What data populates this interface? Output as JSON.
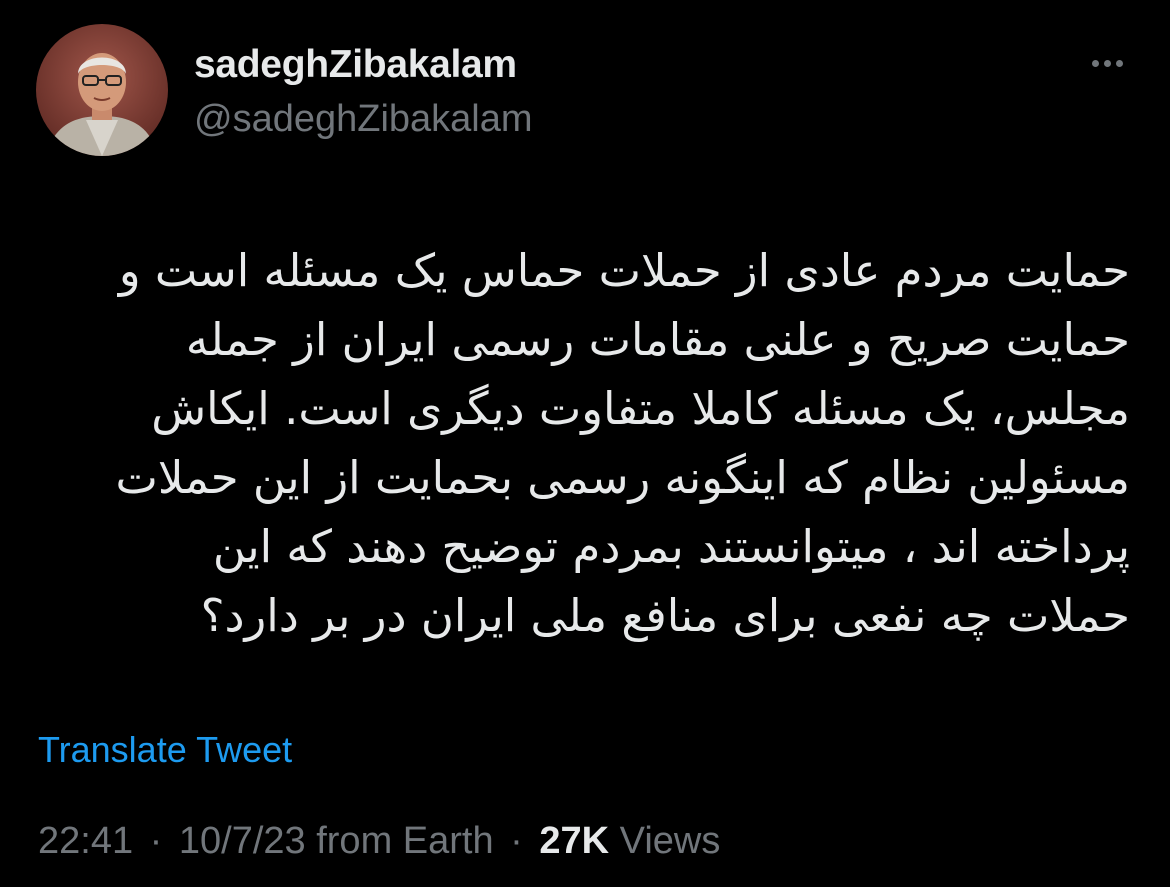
{
  "theme": {
    "background": "#000000",
    "text_primary": "#e7e9ea",
    "text_secondary": "#71767b",
    "link": "#1d9bf0"
  },
  "author": {
    "display_name": "sadeghZibakalam",
    "handle": "@sadeghZibakalam",
    "avatar_icon": "user-avatar-photo"
  },
  "menu": {
    "more_icon": "more-horizontal-icon"
  },
  "tweet": {
    "text": "حمایت مردم عادی از حملات حماس یک مسئله است و\nحمایت صریح و علنی مقامات رسمی ایران از جمله\nمجلس، یک مسئله کاملا متفاوت دیگری است. ایکاش\nمسئولین نظام که اینگونه رسمی بحمایت از این حملات\nپرداخته اند ، میتوانستند بمردم توضیح دهند که این\nحملات چه نفعی برای منافع ملی ایران در بر دارد؟"
  },
  "translate": {
    "label": "Translate Tweet"
  },
  "meta": {
    "time": "22:41",
    "date": "10/7/23 from Earth",
    "separator": "·",
    "views_count": "27K",
    "views_label": "Views"
  }
}
